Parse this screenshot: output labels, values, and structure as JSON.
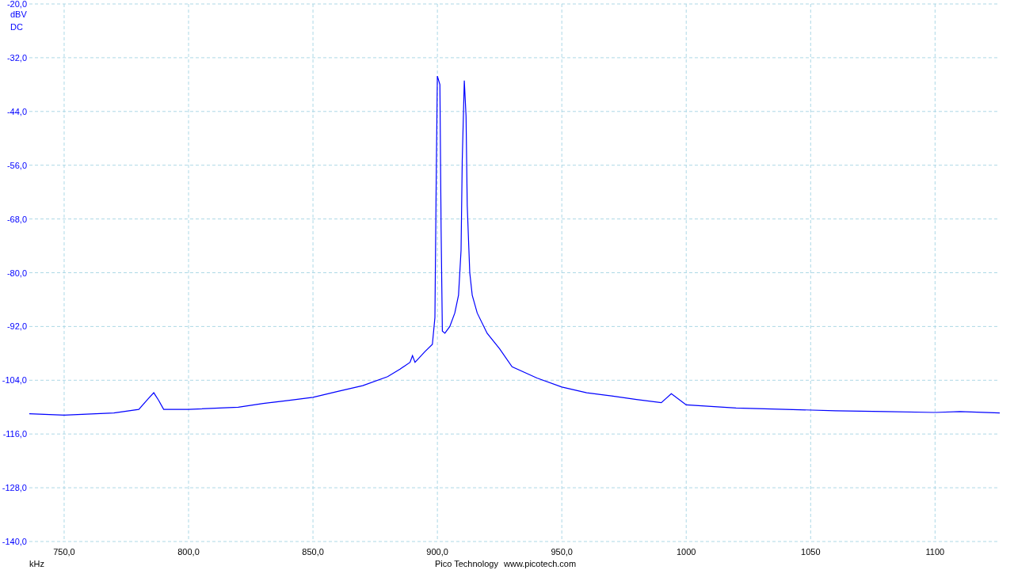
{
  "chart": {
    "y_unit": "dBV",
    "coupling": "DC",
    "x_unit": "kHz",
    "chart_data": {
      "type": "line",
      "grid": true,
      "xlim": [
        736,
        1126
      ],
      "ylim": [
        -140,
        -20
      ],
      "xticks": [
        {
          "value": 750,
          "label": "750,0"
        },
        {
          "value": 800,
          "label": "800,0"
        },
        {
          "value": 850,
          "label": "850,0"
        },
        {
          "value": 900,
          "label": "900,0"
        },
        {
          "value": 950,
          "label": "950,0"
        },
        {
          "value": 1000,
          "label": "1000"
        },
        {
          "value": 1050,
          "label": "1050"
        },
        {
          "value": 1100,
          "label": "1100"
        }
      ],
      "yticks": [
        {
          "value": -20,
          "label": "-20,0"
        },
        {
          "value": -32,
          "label": "-32,0"
        },
        {
          "value": -44,
          "label": "-44,0"
        },
        {
          "value": -56,
          "label": "-56,0"
        },
        {
          "value": -68,
          "label": "-68,0"
        },
        {
          "value": -80,
          "label": "-80,0"
        },
        {
          "value": -92,
          "label": "-92,0"
        },
        {
          "value": -104,
          "label": "-104,0"
        },
        {
          "value": -116,
          "label": "-116,0"
        },
        {
          "value": -128,
          "label": "-128,0"
        },
        {
          "value": -140,
          "label": "-140,0"
        }
      ],
      "x": [
        736,
        750,
        770,
        780,
        784,
        786,
        788,
        790,
        800,
        820,
        830,
        840,
        850,
        860,
        870,
        880,
        885,
        889,
        890,
        891,
        895,
        898,
        899,
        899.5,
        900,
        901,
        901.5,
        902,
        903,
        905,
        907,
        908.5,
        909.5,
        910,
        910.8,
        911.5,
        912,
        913,
        914,
        916,
        920,
        925,
        930,
        940,
        950,
        960,
        970,
        980,
        990,
        994,
        1000,
        1020,
        1040,
        1060,
        1080,
        1100,
        1110,
        1126
      ],
      "series": [
        {
          "color": "#0000ff",
          "values": [
            -111.5,
            -111.8,
            -111.3,
            -110.5,
            -108,
            -106.8,
            -108.5,
            -110.5,
            -110.5,
            -110,
            -109.2,
            -108.5,
            -107.8,
            -106.5,
            -105.2,
            -103.2,
            -101.5,
            -100,
            -98.5,
            -100,
            -97.6,
            -96,
            -90,
            -60,
            -36.1,
            -38,
            -70,
            -93,
            -93.5,
            -92,
            -89,
            -85,
            -75,
            -55,
            -37.1,
            -45,
            -65,
            -80,
            -85,
            -89,
            -93.5,
            -97,
            -101,
            -103.5,
            -105.5,
            -106.8,
            -107.5,
            -108.3,
            -109,
            -107,
            -109.5,
            -110.2,
            -110.5,
            -110.8,
            -111,
            -111.2,
            -111,
            -111.3
          ]
        }
      ]
    }
  },
  "footer": {
    "company": "Pico Technology",
    "website": "www.picotech.com"
  }
}
